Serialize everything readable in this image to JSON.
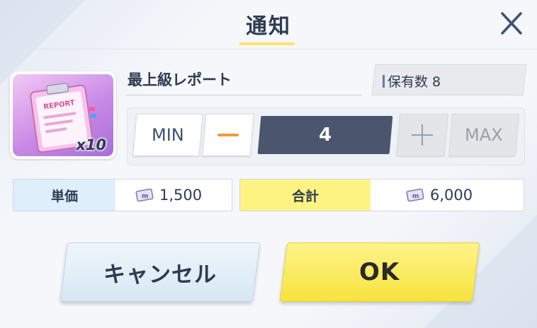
{
  "dialog": {
    "title": "通知",
    "close_icon": "close-icon"
  },
  "item": {
    "name": "最上級レポート",
    "icon": "report-clipboard-icon",
    "icon_label": "REPORT",
    "bundle_qty": "x10",
    "owned_label": "保有数 8"
  },
  "quantity": {
    "min_label": "MIN",
    "minus_icon": "minus-icon",
    "value": "4",
    "plus_icon": "plus-icon",
    "max_label": "MAX"
  },
  "price": {
    "unit_label": "単価",
    "unit_value": "1,500",
    "total_label": "合計",
    "total_value": "6,000",
    "currency_icon": "ticket-icon"
  },
  "actions": {
    "cancel_label": "キャンセル",
    "ok_label": "OK"
  },
  "colors": {
    "accent_yellow": "#fdf383",
    "unit_blue": "#dfeefb",
    "qty_field": "#4a566d",
    "minus_orange": "#f29b38",
    "text_dark": "#2e3b52"
  }
}
